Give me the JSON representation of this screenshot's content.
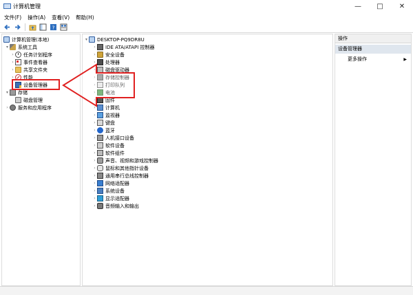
{
  "window": {
    "title": "计算机管理",
    "buttons": {
      "minimize": "—",
      "maximize": "□",
      "close": "✕"
    }
  },
  "menu": [
    "文件(F)",
    "操作(A)",
    "查看(V)",
    "帮助(H)"
  ],
  "toolbar": [
    "back-icon",
    "forward-icon",
    "up-folder-icon",
    "show-tree-icon",
    "help-icon",
    "properties-icon"
  ],
  "left_tree": {
    "root": "计算机管理(本地)",
    "system_tools": "系统工具",
    "system_tools_children": [
      "任务计划程序",
      "事件查看器",
      "共享文件夹",
      "性能",
      "设备管理器"
    ],
    "storage": "存储",
    "storage_children": [
      "磁盘管理"
    ],
    "services": "服务和应用程序"
  },
  "device_tree": {
    "root": "DESKTOP-PQ9DR8U",
    "categories": [
      "IDE ATA/ATAPI 控制器",
      "安全设备",
      "处理器",
      "磁盘驱动器",
      "存储控制器",
      "打印队列",
      "电池",
      "固件",
      "计算机",
      "监视器",
      "键盘",
      "蓝牙",
      "人机接口设备",
      "软件设备",
      "软件组件",
      "声音、视频和游戏控制器",
      "鼠标和其他指针设备",
      "通用串行总线控制器",
      "网络适配器",
      "系统设备",
      "显示适配器",
      "音频输入和输出"
    ]
  },
  "actions": {
    "header": "操作",
    "selected": "设备管理器",
    "more": "更多操作"
  },
  "colors": {
    "highlight": "#e02020",
    "selection": "#dfe6ee"
  }
}
